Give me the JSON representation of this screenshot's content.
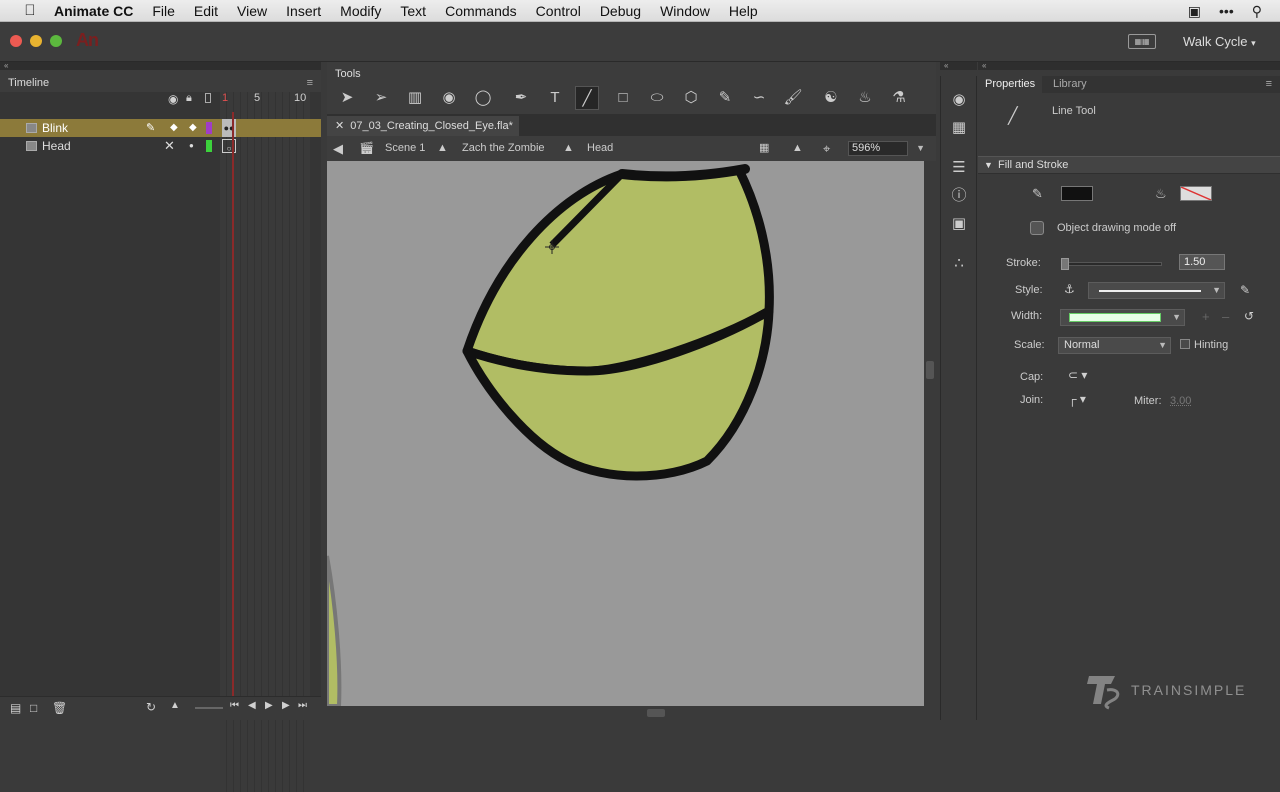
{
  "menubar": {
    "app_name": "Animate CC",
    "items": [
      "File",
      "Edit",
      "View",
      "Insert",
      "Modify",
      "Text",
      "Commands",
      "Control",
      "Debug",
      "Window",
      "Help"
    ]
  },
  "appbar": {
    "logo": "An",
    "workspace": "Walk Cycle"
  },
  "timeline": {
    "title": "Timeline",
    "frame_numbers": [
      "1",
      "5",
      "10"
    ],
    "layers": [
      {
        "name": "Blink",
        "selected": true
      },
      {
        "name": "Head",
        "selected": false
      }
    ]
  },
  "tools": {
    "title": "Tools"
  },
  "document": {
    "tab_title": "07_03_Creating_Closed_Eye.fla*",
    "breadcrumbs": [
      "Scene 1",
      "Zach the Zombie",
      "Head"
    ],
    "zoom": "596%"
  },
  "properties": {
    "tabs": [
      "Properties",
      "Library"
    ],
    "tool_name": "Line Tool",
    "section": "Fill and Stroke",
    "object_drawing_mode": "Object drawing mode off",
    "stroke_label": "Stroke:",
    "stroke_value": "1.50",
    "style_label": "Style:",
    "width_label": "Width:",
    "scale_label": "Scale:",
    "scale_value": "Normal",
    "hinting_label": "Hinting",
    "cap_label": "Cap:",
    "join_label": "Join:",
    "miter_label": "Miter:",
    "miter_value": "3.00",
    "stroke_color": "#111111"
  },
  "watermark": "TRAINSIMPLE",
  "colors": {
    "eye_fill": "#b1bd64",
    "stroke": "#111111",
    "stage": "#999999",
    "selected_layer": "#8c7a3a"
  }
}
